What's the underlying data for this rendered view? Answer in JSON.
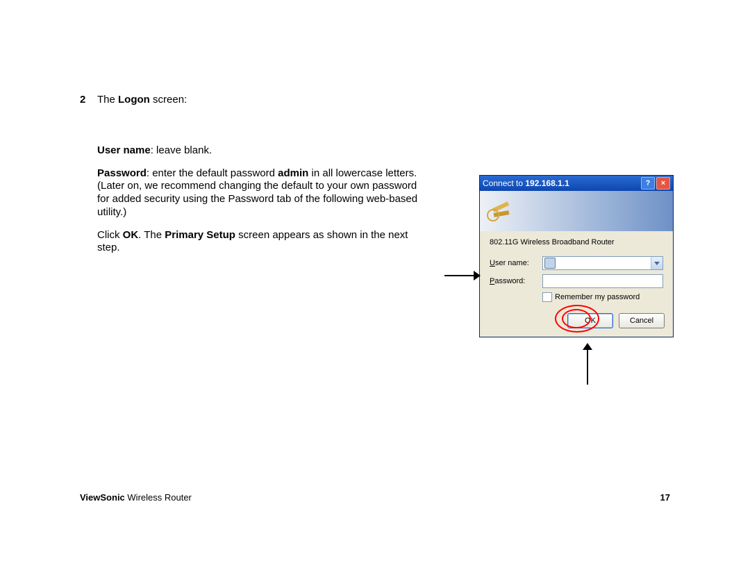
{
  "step": {
    "number": "2",
    "line1_pre": "The ",
    "line1_bold": "Logon",
    "line1_post": " screen:"
  },
  "para_username": {
    "bold": "User name",
    "rest": ": leave blank."
  },
  "para_password": {
    "b1": "Password",
    "t1": ": enter  the default password ",
    "b2": "admin",
    "t2": " in all lowercase letters. (Later on, we recommend changing the default to your own password for added security using the Password tab of the following web-based utility.)"
  },
  "para_click": {
    "t1": "Click ",
    "b1": "OK",
    "t2": ". The ",
    "b2": "Primary Setup",
    "t3": " screen appears as shown in the next step."
  },
  "dialog": {
    "title_pre": "Connect to ",
    "title_ip": "192.168.1.1",
    "realm": "802.11G Wireless Broadband Router",
    "user_u": "U",
    "user_rest": "ser name:",
    "pass_u": "P",
    "pass_rest": "assword:",
    "remember_u": "R",
    "remember_rest": "emember my password",
    "ok": "OK",
    "cancel": "Cancel"
  },
  "footer": {
    "brand": "ViewSonic",
    "product": " Wireless Router",
    "page": "17"
  }
}
